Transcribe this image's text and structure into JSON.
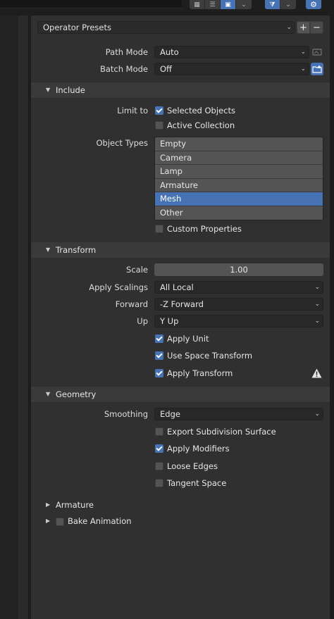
{
  "toolbar": {
    "view_icons": [
      "grid-view-icon",
      "list-view-icon",
      "thumbnail-view-icon"
    ],
    "filter_icon": "filter-icon",
    "settings_icon": "gear-icon"
  },
  "presets": {
    "label": "Operator Presets",
    "add": "+",
    "remove": "−"
  },
  "path_mode": {
    "label": "Path Mode",
    "value": "Auto"
  },
  "batch_mode": {
    "label": "Batch Mode",
    "value": "Off"
  },
  "include": {
    "title": "Include",
    "limit_to_label": "Limit to",
    "selected_objects": {
      "label": "Selected Objects",
      "checked": true
    },
    "active_collection": {
      "label": "Active Collection",
      "checked": false
    },
    "object_types_label": "Object Types",
    "object_types": [
      {
        "label": "Empty",
        "selected": false
      },
      {
        "label": "Camera",
        "selected": false
      },
      {
        "label": "Lamp",
        "selected": false
      },
      {
        "label": "Armature",
        "selected": false
      },
      {
        "label": "Mesh",
        "selected": true
      },
      {
        "label": "Other",
        "selected": false
      }
    ],
    "custom_properties": {
      "label": "Custom Properties",
      "checked": false
    }
  },
  "transform": {
    "title": "Transform",
    "scale_label": "Scale",
    "scale_value": "1.00",
    "apply_scalings_label": "Apply Scalings",
    "apply_scalings_value": "All Local",
    "forward_label": "Forward",
    "forward_value": "-Z Forward",
    "up_label": "Up",
    "up_value": "Y Up",
    "apply_unit": {
      "label": "Apply Unit",
      "checked": true
    },
    "use_space_transform": {
      "label": "Use Space Transform",
      "checked": true
    },
    "apply_transform": {
      "label": "Apply Transform",
      "checked": true
    }
  },
  "geometry": {
    "title": "Geometry",
    "smoothing_label": "Smoothing",
    "smoothing_value": "Edge",
    "export_subdivision": {
      "label": "Export Subdivision Surface",
      "checked": false
    },
    "apply_modifiers": {
      "label": "Apply Modifiers",
      "checked": true
    },
    "loose_edges": {
      "label": "Loose Edges",
      "checked": false
    },
    "tangent_space": {
      "label": "Tangent Space",
      "checked": false
    }
  },
  "armature": {
    "title": "Armature"
  },
  "bake_animation": {
    "title": "Bake Animation",
    "checked": false
  },
  "colors": {
    "accent": "#4772b3",
    "panel": "#303030",
    "header": "#3a3a3a"
  }
}
